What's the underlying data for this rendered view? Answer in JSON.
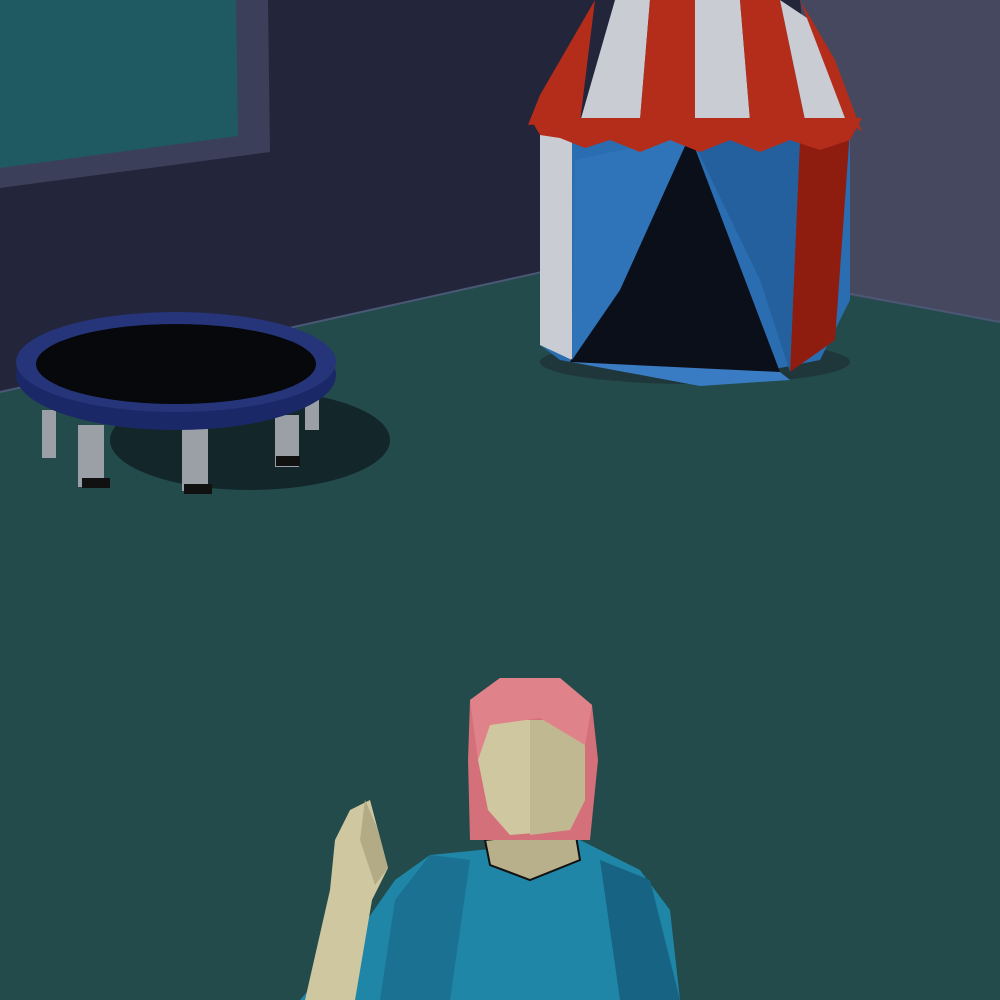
{
  "scene": {
    "colors": {
      "wall_left": "#23253a",
      "wall_right": "#45485f",
      "floor": "#234b4b",
      "window": "#1f5a63",
      "window_frame": "#3b3f5a",
      "tent_red": "#b42c1a",
      "tent_white": "#c9ccd3",
      "tent_blue": "#2a6db0",
      "trampoline_rim": "#1c2a66",
      "trampoline_mat": "#07080c",
      "hair": "#d4707a",
      "skin": "#cfc79f",
      "shirt": "#1f86a8"
    }
  }
}
